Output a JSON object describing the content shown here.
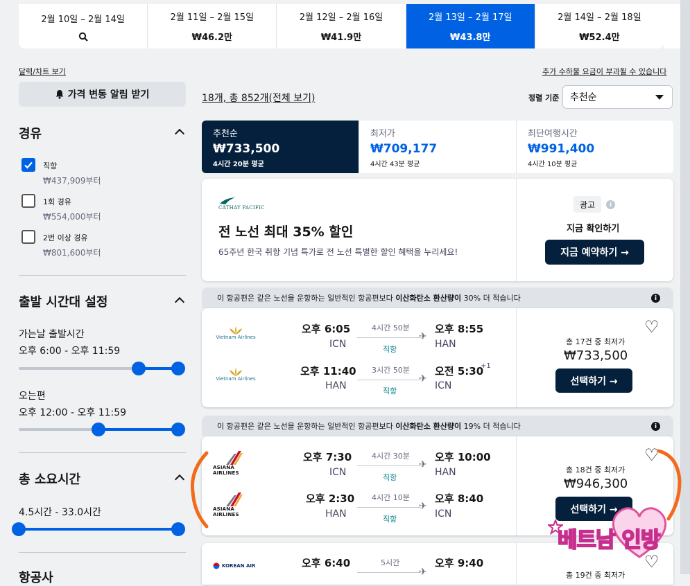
{
  "date_tabs": [
    {
      "dates": "2월 10일 – 2월 14일",
      "price": "",
      "icon": "search-icon",
      "selected": false
    },
    {
      "dates": "2월 11일 – 2월 15일",
      "price": "₩46.2만",
      "selected": false
    },
    {
      "dates": "2월 12일 – 2월 16일",
      "price": "₩41.9만",
      "selected": false
    },
    {
      "dates": "2월 13일 – 2월 17일",
      "price": "₩43.8만",
      "selected": true
    },
    {
      "dates": "2월 14일 – 2월 18일",
      "price": "₩52.4만",
      "selected": false
    }
  ],
  "sidebar": {
    "calendar_link": "달력/차트 보기",
    "alert_button": "가격 변동 알림 받기",
    "stops": {
      "title": "경유",
      "options": [
        {
          "label": "직항",
          "price": "₩437,909부터",
          "checked": true
        },
        {
          "label": "1회 경유",
          "price": "₩554,000부터",
          "checked": false
        },
        {
          "label": "2번 이상 경유",
          "price": "₩801,600부터",
          "checked": false
        }
      ]
    },
    "departure_time": {
      "title": "출발 시간대 설정",
      "outbound_label": "가는날 출발시간",
      "outbound_range": "오후 6:00 - 오후 11:59",
      "outbound_fraction": [
        0.75,
        1.0
      ],
      "return_label": "오는편",
      "return_range": "오후 12:00 - 오후 11:59",
      "return_fraction": [
        0.5,
        1.0
      ]
    },
    "duration": {
      "title": "총 소요시간",
      "range": "4.5시간 - 33.0시간",
      "fraction": [
        0.0,
        1.0
      ]
    },
    "airline_title": "항공사"
  },
  "main": {
    "extra_fees_link": "추가 수하물 요금이 부과될 수 있습니다",
    "results_count": "18개, 총 852개(전체 보기)",
    "sort_label": "정렬 기준",
    "sort_value": "추천순",
    "sort_tabs": [
      {
        "name": "추천순",
        "price": "₩733,500",
        "sub": "4시간 20분 평균",
        "selected": true
      },
      {
        "name": "최저가",
        "price": "₩709,177",
        "sub": "4시간 43분 평균",
        "selected": false
      },
      {
        "name": "최단여행시간",
        "price": "₩991,400",
        "sub": "4시간 10분 평균",
        "selected": false
      }
    ],
    "ad": {
      "logo": "CATHAY PACIFIC",
      "headline": "전 노선 최대 35% 할인",
      "body": "65주년 한국 취항 기념 특가로 전 노선 특별한 할인 혜택을 누리세요!",
      "badge": "광고",
      "cta_label": "지금 확인하기",
      "cta_button": "지금 예약하기 →"
    },
    "results": [
      {
        "eco_prefix": "이 항공편은 같은 노선을 운항하는 일반적인 항공편보다 ",
        "eco_bold": "이산화탄소 환산량이",
        "eco_suffix": " 30% 더 적습니다",
        "legs": [
          {
            "airline": "Vietnam Airlines",
            "dep_time": "오후 6:05",
            "dep_apt": "ICN",
            "duration": "4시간 50분",
            "stops": "직항",
            "arr_time": "오후 8:55",
            "arr_apt": "HAN",
            "plus": ""
          },
          {
            "airline": "Vietnam Airlines",
            "dep_time": "오후 11:40",
            "dep_apt": "HAN",
            "duration": "3시간 50분",
            "stops": "직항",
            "arr_time": "오전 5:30",
            "arr_apt": "ICN",
            "plus": "+1"
          }
        ],
        "deals": "총 17건 중 최저가",
        "price": "₩733,500",
        "button": "선택하기 →"
      },
      {
        "eco_prefix": "이 항공편은 같은 노선을 운항하는 일반적인 항공편보다 ",
        "eco_bold": "이산화탄소 환산량이",
        "eco_suffix": " 19% 더 적습니다",
        "legs": [
          {
            "airline": "ASIANA AIRLINES",
            "dep_time": "오후 7:30",
            "dep_apt": "ICN",
            "duration": "4시간 30분",
            "stops": "직항",
            "arr_time": "오후 10:00",
            "arr_apt": "HAN",
            "plus": ""
          },
          {
            "airline": "ASIANA AIRLINES",
            "dep_time": "오후 2:30",
            "dep_apt": "HAN",
            "duration": "4시간 10분",
            "stops": "직항",
            "arr_time": "오후 8:40",
            "arr_apt": "ICN",
            "plus": ""
          }
        ],
        "deals": "총 18건 중 최저가",
        "price": "₩946,300",
        "button": "선택하기 →"
      },
      {
        "airline": "KOREAN AIR",
        "dep_time": "오후 6:40",
        "duration": "5시간",
        "arr_time": "오후 9:40",
        "deals": "총 19건 중 최저가"
      }
    ]
  },
  "watermark": "베트남 인방",
  "colors": {
    "accent": "#0062e3",
    "dark": "#05203c",
    "eco_text": "#0c838a",
    "annotation": "#f26b1d"
  }
}
